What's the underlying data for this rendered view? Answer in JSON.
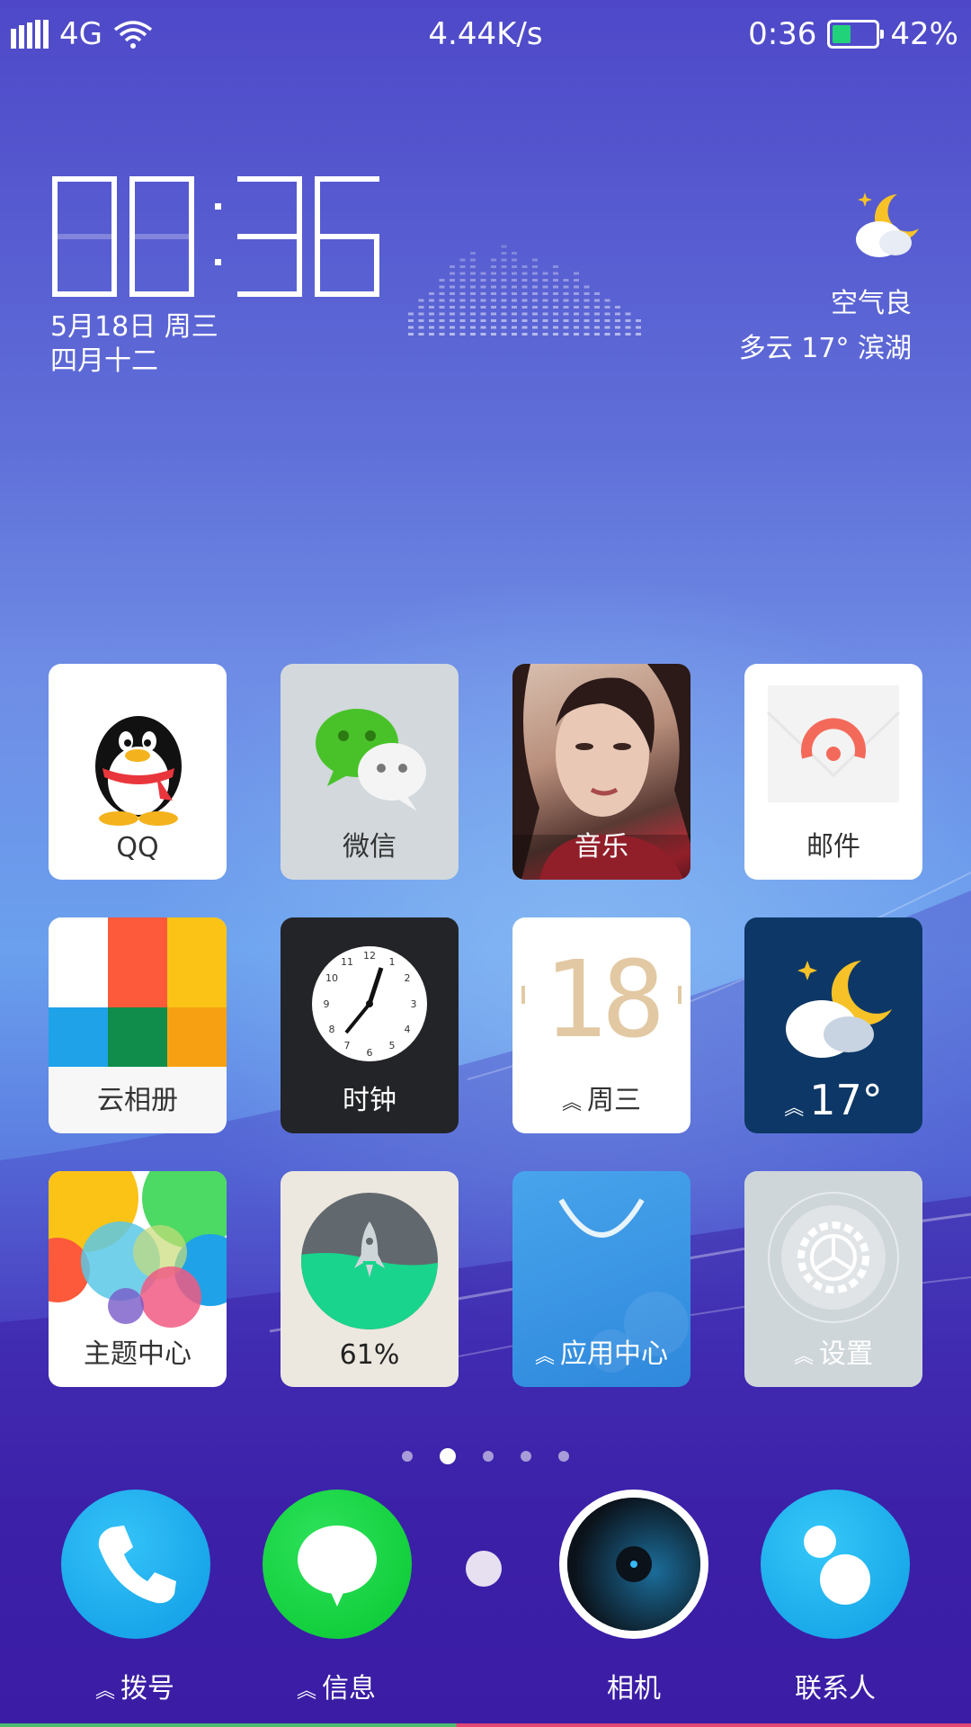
{
  "status_bar": {
    "network": "4G",
    "speed": "4.44K/s",
    "time": "0:36",
    "battery_percent": "42%",
    "battery_level": 0.42
  },
  "clock_widget": {
    "time_digits": [
      "0",
      "0",
      "3",
      "6"
    ],
    "date": "5月18日 周三",
    "lunar_date": "四月十二"
  },
  "weather_widget": {
    "air_quality": "空气良",
    "forecast": "多云 17° 滨湖",
    "icon": "partly-cloudy-night-icon"
  },
  "apps": [
    {
      "label": "QQ",
      "icon": "qq-penguin-icon"
    },
    {
      "label": "微信",
      "icon": "wechat-icon"
    },
    {
      "label": "音乐",
      "icon": "music-album-cover"
    },
    {
      "label": "邮件",
      "icon": "mail-icon"
    },
    {
      "label": "云相册",
      "icon": "cloud-album-icon"
    },
    {
      "label": "时钟",
      "icon": "clock-icon"
    },
    {
      "label": "周三",
      "icon": "calendar-icon",
      "day_number": "18"
    },
    {
      "label": "17°",
      "icon": "weather-icon"
    },
    {
      "label": "主题中心",
      "icon": "theme-center-icon"
    },
    {
      "label": "61%",
      "icon": "cleaner-rocket-icon",
      "level": 0.61
    },
    {
      "label": "应用中心",
      "icon": "app-store-bag-icon"
    },
    {
      "label": "设置",
      "icon": "gear-icon"
    }
  ],
  "page_indicator": {
    "count": 5,
    "active_index": 1
  },
  "dock": [
    {
      "label": "拨号",
      "icon": "phone-icon"
    },
    {
      "label": "信息",
      "icon": "message-icon"
    },
    {
      "label": "相机",
      "icon": "camera-icon"
    },
    {
      "label": "联系人",
      "icon": "contacts-icon"
    }
  ],
  "colors": {
    "battery_fill": "#22d27a",
    "wechat_green": "#49c22a",
    "dock_phone": "#19aef0",
    "dock_message": "#0cd33b",
    "weather_tile": "#0d3766",
    "clock_tile": "#232428",
    "app_center_tile": "#3e97e4"
  }
}
